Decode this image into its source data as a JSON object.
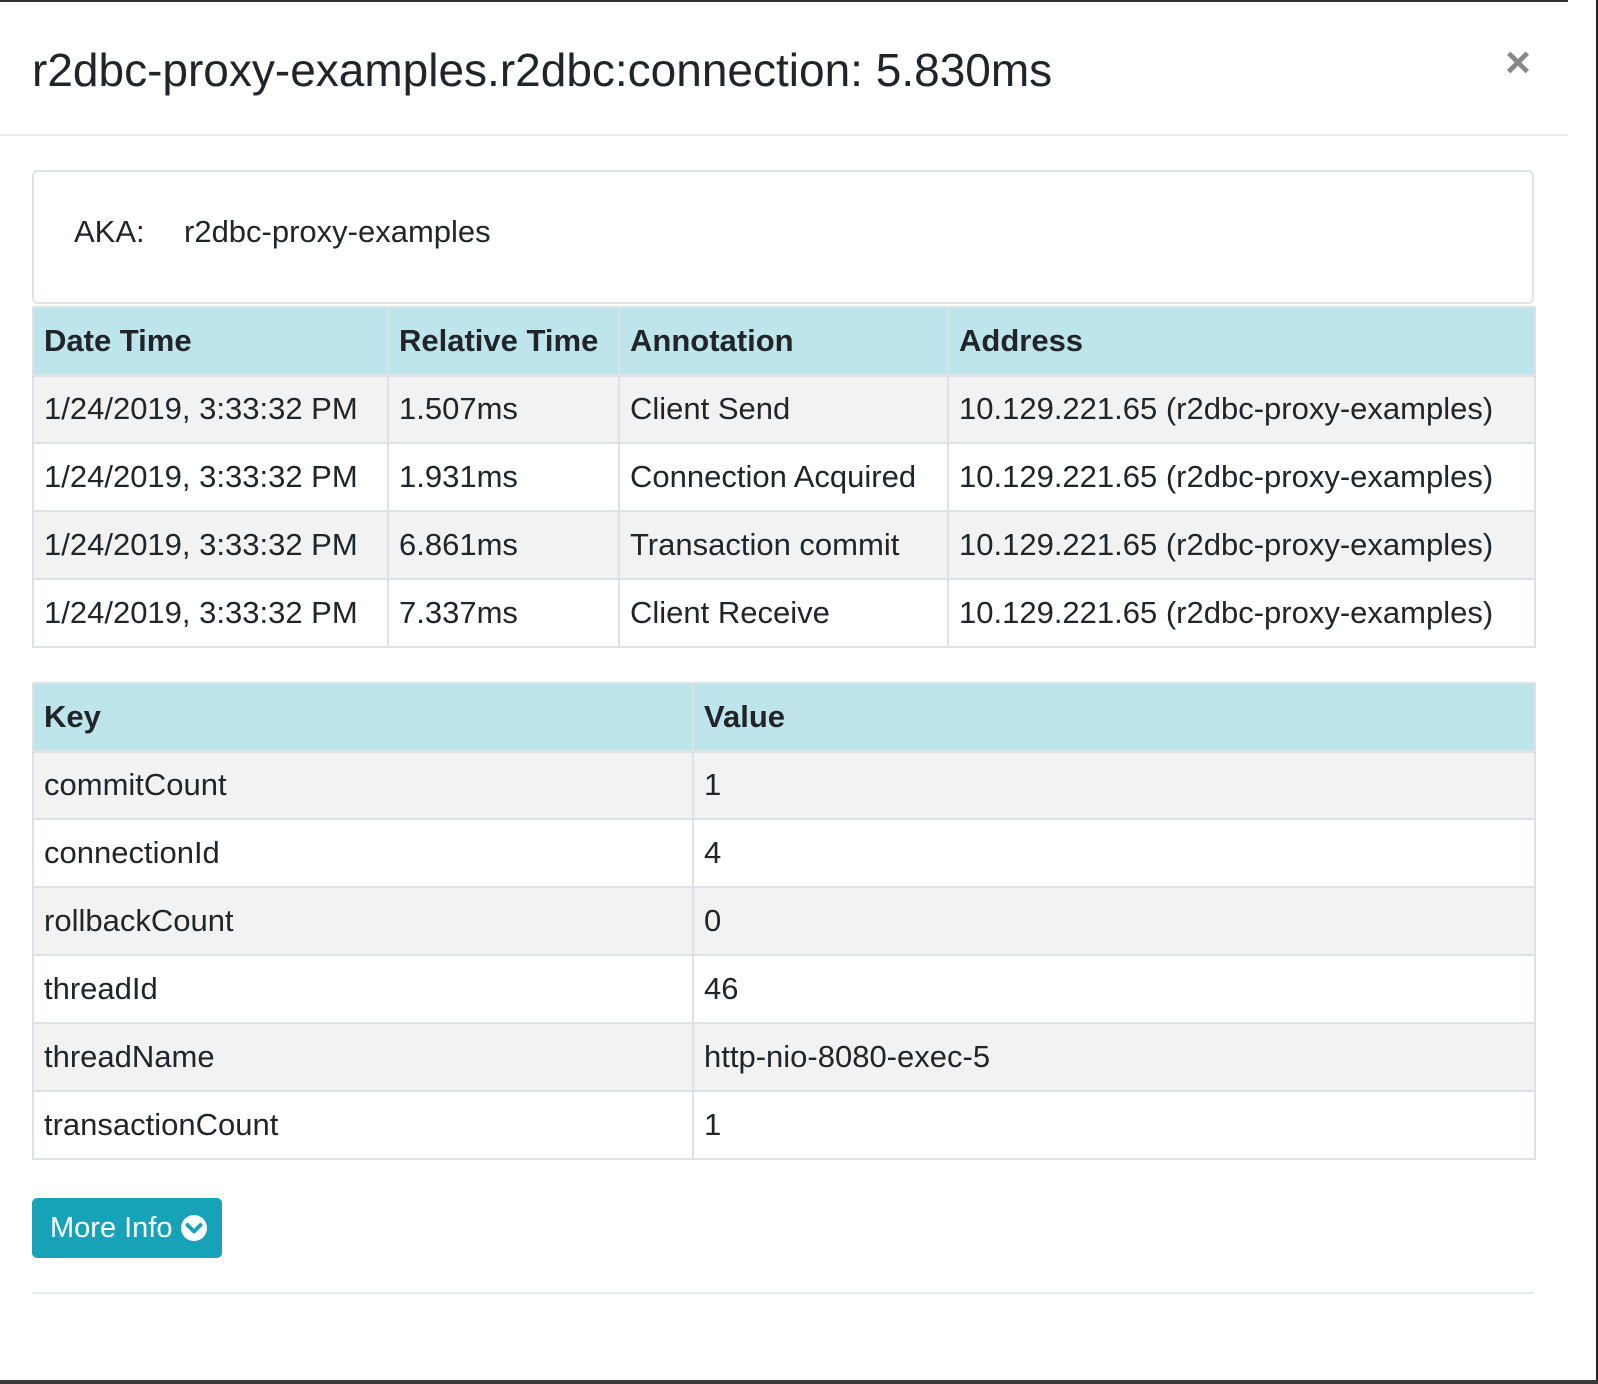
{
  "modal": {
    "title": "r2dbc-proxy-examples.r2dbc:connection: 5.830ms",
    "close_label": "×"
  },
  "aka": {
    "label": "AKA:",
    "value": "r2dbc-proxy-examples"
  },
  "annotations": {
    "headers": [
      "Date Time",
      "Relative Time",
      "Annotation",
      "Address"
    ],
    "rows": [
      [
        "1/24/2019, 3:33:32 PM",
        "1.507ms",
        "Client Send",
        "10.129.221.65 (r2dbc-proxy-examples)"
      ],
      [
        "1/24/2019, 3:33:32 PM",
        "1.931ms",
        "Connection Acquired",
        "10.129.221.65 (r2dbc-proxy-examples)"
      ],
      [
        "1/24/2019, 3:33:32 PM",
        "6.861ms",
        "Transaction commit",
        "10.129.221.65 (r2dbc-proxy-examples)"
      ],
      [
        "1/24/2019, 3:33:32 PM",
        "7.337ms",
        "Client Receive",
        "10.129.221.65 (r2dbc-proxy-examples)"
      ]
    ]
  },
  "tags": {
    "headers": [
      "Key",
      "Value"
    ],
    "rows": [
      [
        "commitCount",
        "1"
      ],
      [
        "connectionId",
        "4"
      ],
      [
        "rollbackCount",
        "0"
      ],
      [
        "threadId",
        "46"
      ],
      [
        "threadName",
        "http-nio-8080-exec-5"
      ],
      [
        "transactionCount",
        "1"
      ]
    ]
  },
  "more_info": {
    "label": "More Info",
    "icon": "chevron-down-circle-icon"
  },
  "colors": {
    "header_bg": "#bee5eb",
    "button_bg": "#17a2b8",
    "stripe_bg": "#f2f2f2"
  }
}
